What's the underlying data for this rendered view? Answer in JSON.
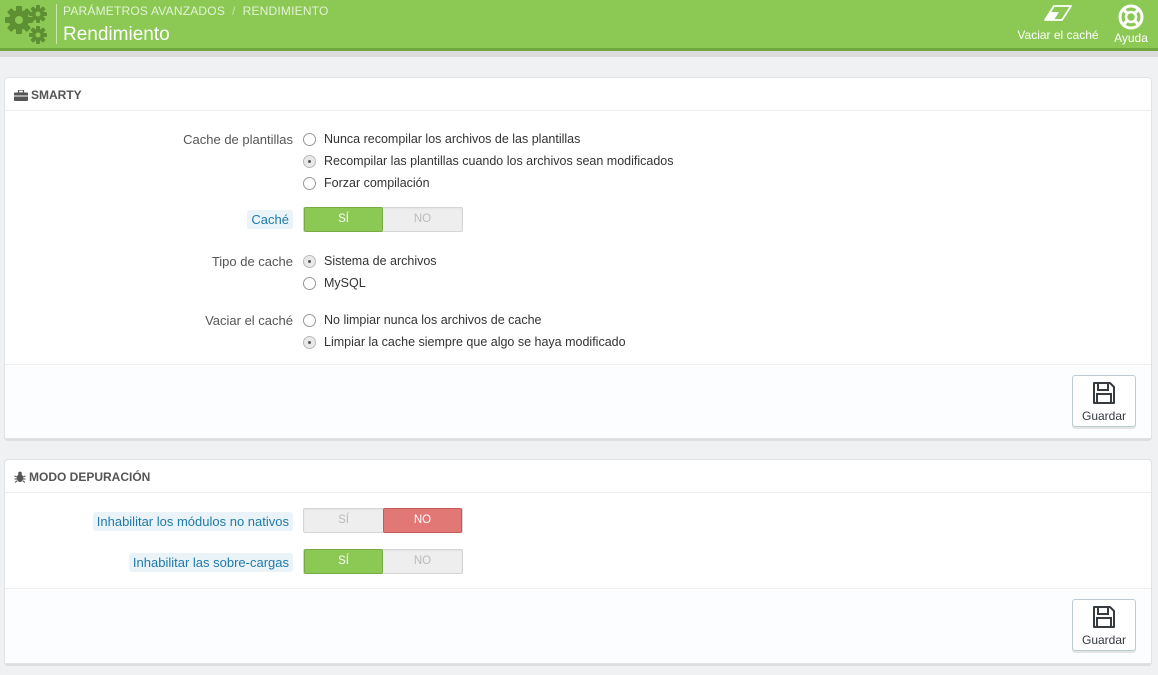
{
  "header": {
    "breadcrumb": [
      "PARÁMETROS AVANZADOS",
      "RENDIMIENTO"
    ],
    "breadcrumb_separator": "/",
    "title": "Rendimiento",
    "toolbar": {
      "clear_cache_label": "Vaciar el caché",
      "help_label": "Ayuda"
    },
    "colors": {
      "bar": "#8bc954",
      "bar_border": "#70a83f"
    }
  },
  "smarty": {
    "heading": "SMARTY",
    "template_cache": {
      "label": "Cache de plantillas",
      "options": [
        "Nunca recompilar los archivos de las plantillas",
        "Recompilar las plantillas cuando los archivos sean modificados",
        "Forzar compilación"
      ],
      "selected": 1
    },
    "cache": {
      "label": "Caché",
      "yes": "SÍ",
      "no": "NO",
      "value": "yes"
    },
    "cache_type": {
      "label": "Tipo de cache",
      "options": [
        "Sistema de archivos",
        "MySQL"
      ],
      "selected": 0
    },
    "clear_cache": {
      "label": "Vaciar el caché",
      "options": [
        "No limpiar nunca los archivos de cache",
        "Limpiar la cache siempre que algo se haya modificado"
      ],
      "selected": 1
    },
    "save_label": "Guardar"
  },
  "debug": {
    "heading": "MODO DEPURACIÓN",
    "disable_non_native_modules": {
      "label": "Inhabilitar los módulos no nativos",
      "yes": "SÍ",
      "no": "NO",
      "value": "no"
    },
    "disable_overrides": {
      "label": "Inhabilitar las sobre-cargas",
      "yes": "SÍ",
      "no": "NO",
      "value": "yes"
    },
    "save_label": "Guardar"
  },
  "icons": [
    "gears-icon",
    "eraser-icon",
    "lifebuoy-icon",
    "briefcase-icon",
    "bug-icon",
    "save-icon"
  ],
  "colors": {
    "switch_on": "#8bc954",
    "switch_off_active": "#e17875",
    "hint_text": "#1f7aaa"
  }
}
